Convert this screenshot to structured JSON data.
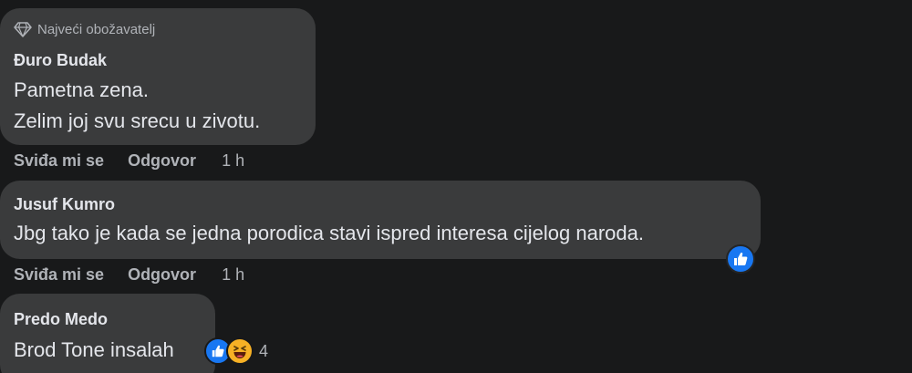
{
  "colors": {
    "background": "#18191a",
    "bubble": "#3a3b3c",
    "text": "#e4e6eb",
    "secondary_text": "#b0b3b8",
    "like_blue": "#1877f2",
    "haha_yellow": "#f7b125"
  },
  "comments": [
    {
      "badge": {
        "icon": "diamond-icon",
        "label": "Najveći obožavatelj"
      },
      "author": "Đuro Budak",
      "lines": [
        "Pametna zena.",
        "Zelim joj svu srecu u zivotu."
      ],
      "actions": {
        "like": "Sviđa mi se",
        "reply": "Odgovor",
        "time": "1 h"
      }
    },
    {
      "author": "Jusuf Kumro",
      "lines": [
        "Jbg tako je kada se jedna porodica stavi ispred interesa cijelog naroda."
      ],
      "actions": {
        "like": "Sviđa mi se",
        "reply": "Odgovor",
        "time": "1 h"
      },
      "reactions": {
        "icons": [
          "like-reaction-icon"
        ]
      }
    },
    {
      "author": "Predo Medo",
      "lines": [
        "Brod Tone insalah"
      ],
      "reactions": {
        "icons": [
          "like-reaction-icon",
          "haha-reaction-icon"
        ],
        "count": "4"
      }
    }
  ]
}
